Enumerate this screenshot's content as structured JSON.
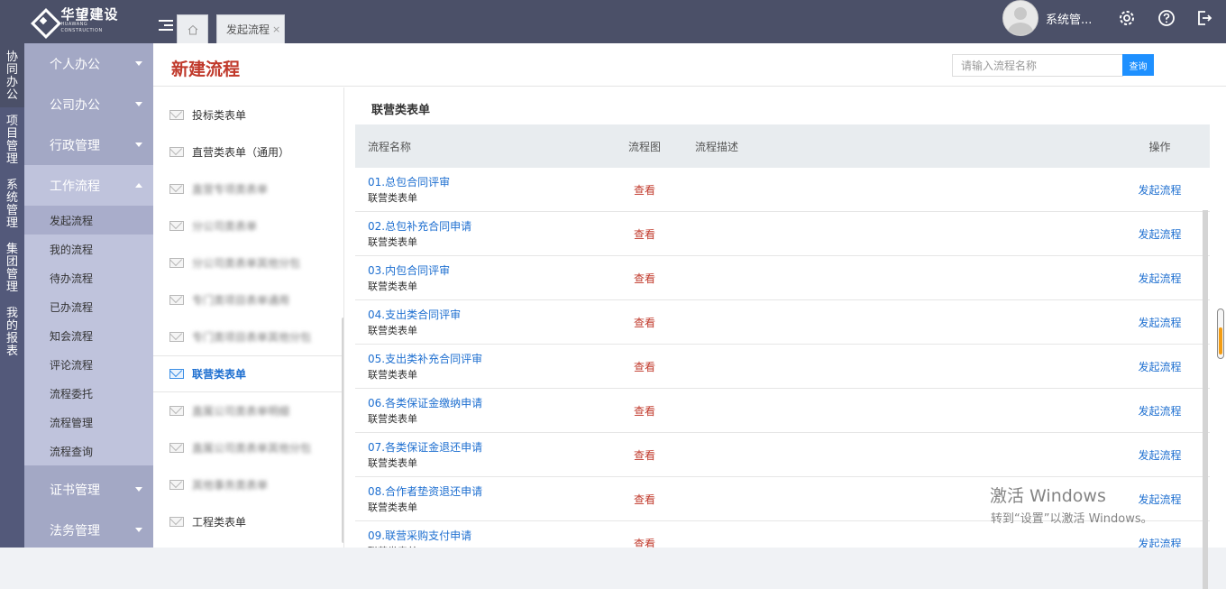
{
  "app": {
    "logo_cn": "华望建设",
    "logo_en": "HUAWANG CONSTRUCTION",
    "user": "系统管...",
    "tabs": [
      {
        "label": "发起流程",
        "close": "×"
      }
    ]
  },
  "vertical_nav": [
    {
      "label": "协同办公"
    },
    {
      "label": "项目管理"
    },
    {
      "label": "系统管理"
    },
    {
      "label": "集团管理"
    },
    {
      "label": "我的报表"
    }
  ],
  "menu": {
    "groups_top": [
      "个人办公",
      "公司办公",
      "行政管理"
    ],
    "expanded": {
      "label": "工作流程",
      "items": [
        "发起流程",
        "我的流程",
        "待办流程",
        "已办流程",
        "知会流程",
        "评论流程",
        "流程委托",
        "流程管理",
        "流程查询"
      ]
    },
    "groups_bottom": [
      "证书管理",
      "法务管理"
    ]
  },
  "page": {
    "title": "新建流程",
    "search_placeholder": "请输入流程名称",
    "search_button": "查询"
  },
  "categories": [
    {
      "label": "投标类表单",
      "blurred": false
    },
    {
      "label": "直营类表单（通用）",
      "blurred": false
    },
    {
      "label": "直营专项类表单",
      "blurred": true
    },
    {
      "label": "分公司类表单",
      "blurred": true
    },
    {
      "label": "分公司类表单其他分包",
      "blurred": true
    },
    {
      "label": "专门类项目表单通用",
      "blurred": true
    },
    {
      "label": "专门类项目表单其他分包",
      "blurred": true
    },
    {
      "label": "联营类表单",
      "blurred": false,
      "active": true
    },
    {
      "label": "直属公司类表单明细",
      "blurred": true
    },
    {
      "label": "直属公司类表单其他分包",
      "blurred": true
    },
    {
      "label": "其他事务类表单",
      "blurred": true
    },
    {
      "label": "工程类表单",
      "blurred": false
    }
  ],
  "section_title": "联营类表单",
  "table": {
    "headers": {
      "name": "流程名称",
      "chart": "流程图",
      "desc": "流程描述",
      "op": "操作"
    },
    "view_label": "查看",
    "start_label": "发起流程",
    "rows": [
      {
        "name": "01.总包合同评审",
        "category": "联营类表单"
      },
      {
        "name": "02.总包补充合同申请",
        "category": "联营类表单"
      },
      {
        "name": "03.内包合同评审",
        "category": "联营类表单"
      },
      {
        "name": "04.支出类合同评审",
        "category": "联营类表单"
      },
      {
        "name": "05.支出类补充合同评审",
        "category": "联营类表单"
      },
      {
        "name": "06.各类保证金缴纳申请",
        "category": "联营类表单"
      },
      {
        "name": "07.各类保证金退还申请",
        "category": "联营类表单"
      },
      {
        "name": "08.合作者垫资退还申请",
        "category": "联营类表单"
      },
      {
        "name": "09.联营采购支付申请",
        "category": "联营类表单"
      }
    ]
  },
  "watermark": {
    "line1": "激活 Windows",
    "line2": "转到“设置”以激活 Windows。"
  }
}
